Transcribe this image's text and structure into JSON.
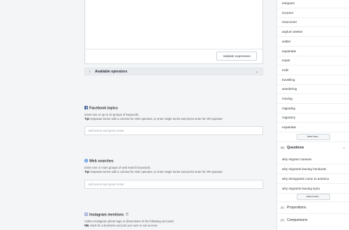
{
  "editor": {
    "validate_label": "Validate expression"
  },
  "operators": {
    "label": "Available operators",
    "info_icon": "i",
    "chevron": "⌄"
  },
  "facebook": {
    "title": "Facebook topics",
    "line1": "Insert one or up to 10 groups of keywords.",
    "tip_label": "Tip!",
    "tip_text": " Separate terms with a comma for AND operator, or enter single terms and press enter for OR operator.",
    "placeholder": "Add terms and press enter",
    "icon_color": "#3b5998"
  },
  "web": {
    "title": "Web searches",
    "line1": "Enter one or more groups of web search keywords.",
    "tip_label": "Tip!",
    "tip_text": " Separate terms with a comma for AND operator, or enter single terms and press enter for OR operator.",
    "placeholder": "Add terms and press enter",
    "icon_color": "#4a90e2"
  },
  "instagram": {
    "title": "Instagram mentions",
    "line1": "Collect Instagram photo tags or @mentions of the following accounts.",
    "nb_label": "NB.",
    "nb_text": " Must be a business account you own or can access.",
    "icon_color": "#8a9bd6"
  },
  "sidebar": {
    "terms": [
      "emigrant",
      "incomer",
      "newcomer",
      "asylum seeker",
      "settler",
      "expatriate",
      "expat",
      "exile",
      "travelling",
      "wandering",
      "moving",
      "migrating",
      "migratory",
      "expatriate"
    ],
    "view_less": "view less...",
    "questions": {
      "count": "14",
      "label": "Questions",
      "chevron": "⌄",
      "items": [
        "why migrant caravan",
        "why migrants leaving honduras",
        "why immigrants come to america",
        "why migrants leaving syria"
      ],
      "view_more": "view more..."
    },
    "propositions": {
      "count": "0",
      "label": "Propositions"
    },
    "comparisons": {
      "count": "0",
      "label": "Comparisons"
    }
  }
}
